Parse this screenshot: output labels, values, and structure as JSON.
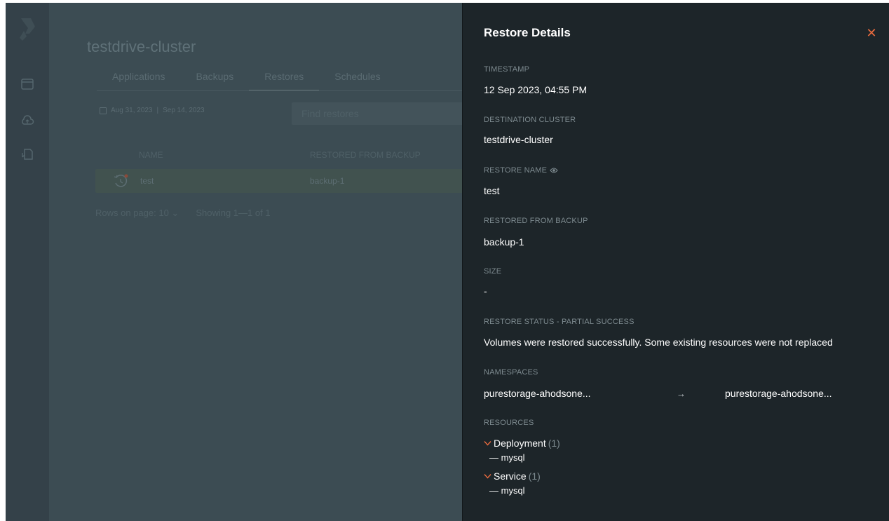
{
  "background": {
    "cluster_title": "testdrive-cluster",
    "tabs": [
      {
        "label": "Applications"
      },
      {
        "label": "Backups"
      },
      {
        "label": "Restores"
      },
      {
        "label": "Schedules"
      }
    ],
    "date_from": "Aug 31, 2023",
    "date_to": "Sep 14, 2023",
    "search_placeholder": "Find restores",
    "columns": {
      "name": "NAME",
      "restored_from": "RESTORED FROM BACKUP"
    },
    "row": {
      "name": "test",
      "backup": "backup-1"
    },
    "pager": {
      "rows_on_page": "Rows on page: 10 ⌄",
      "showing": "Showing 1—1 of 1"
    }
  },
  "panel": {
    "title": "Restore Details",
    "close_symbol": "✕",
    "timestamp_label": "TIMESTAMP",
    "timestamp": "12 Sep 2023, 04:55 PM",
    "dest_cluster_label": "DESTINATION CLUSTER",
    "dest_cluster": "testdrive-cluster",
    "restore_name_label": "RESTORE NAME",
    "restore_name": "test",
    "restored_from_label": "RESTORED FROM BACKUP",
    "restored_from": "backup-1",
    "size_label": "SIZE",
    "size": "-",
    "status_label": "RESTORE STATUS - PARTIAL SUCCESS",
    "status_message": "Volumes were restored successfully. Some existing resources were not replaced",
    "namespaces_label": "NAMESPACES",
    "namespace_source": "purestorage-ahodsone...",
    "namespace_arrow": "→",
    "namespace_target": "purestorage-ahodsone...",
    "resources_label": "RESOURCES",
    "resources": [
      {
        "kind": "Deployment",
        "count": "(1)",
        "items": [
          "— mysql"
        ]
      },
      {
        "kind": "Service",
        "count": "(1)",
        "items": [
          "— mysql"
        ]
      }
    ]
  },
  "colors": {
    "accent": "#e96b3e",
    "panel_bg": "#1d2529",
    "overlay_bg": "#3c4c53"
  }
}
